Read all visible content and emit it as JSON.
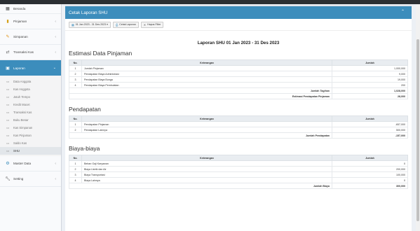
{
  "sidebar": {
    "partial_label": "Beranda",
    "items": [
      {
        "label": "Pinjaman",
        "icon": "money-icon"
      },
      {
        "label": "Simpanan",
        "icon": "pencil-icon"
      },
      {
        "label": "Transaksi Kas",
        "icon": "exchange-icon"
      },
      {
        "label": "Laporan",
        "icon": "book-icon"
      }
    ],
    "sub_items": [
      "Data Anggota",
      "Kas Anggota",
      "Jatuh Tempo",
      "Kredit Macet",
      "Transaksi Kas",
      "Buku Besar",
      "Kas Simpanan",
      "Kas Pinjaman",
      "Saldo Kas",
      "SHU"
    ],
    "bottom_items": [
      {
        "label": "Master Data",
        "icon": "gears-icon"
      },
      {
        "label": "Setting",
        "icon": "wrench-icon"
      }
    ]
  },
  "box": {
    "title": "Cetak Laporan SHU",
    "collapse_glyph": "⌃"
  },
  "toolbar": {
    "date_range": "01 Jan 2023 - 31 Des 2023 ▾",
    "print_label": "Cetak Laporan",
    "clear_label": "Hapus Filter"
  },
  "report": {
    "title": "Laporan SHU 01 Jan 2023 - 31 Des 2023"
  },
  "headers": {
    "no": "No.",
    "ket": "Keterangan",
    "jumlah": "Jumlah"
  },
  "sections": {
    "pinjaman": {
      "title": "Estimasi Data Pinjaman",
      "rows": [
        {
          "no": "1",
          "ket": "Jumlah Pinjaman",
          "amt": "1,000,000"
        },
        {
          "no": "2",
          "ket": "Pendapatan Biaya Administrasi",
          "amt": "9,000"
        },
        {
          "no": "3",
          "ket": "Pendapatan Biaya Bunga",
          "amt": "19,000"
        },
        {
          "no": "4",
          "ket": "Pendapatan Biaya Pembulatan",
          "amt": "200"
        }
      ],
      "sums": [
        {
          "label": "Jumlah Tagihan",
          "amt": "1,028,000"
        },
        {
          "label": "Estimasi Pendapatan Pinjaman",
          "amt": "28,000"
        }
      ]
    },
    "pendapatan": {
      "title": "Pendapatan",
      "rows": [
        {
          "no": "1",
          "ket": "Pendapatan Pinjaman",
          "amt": "-657,000"
        },
        {
          "no": "2",
          "ket": "Pendapatan Lainnya",
          "amt": "500,000"
        }
      ],
      "sums": [
        {
          "label": "Jumlah Pendapatan",
          "amt": "-157,000"
        }
      ]
    },
    "biaya": {
      "title": "Biaya-biaya",
      "rows": [
        {
          "no": "1",
          "ket": "Beban Gaji Karyawan",
          "amt": "0"
        },
        {
          "no": "2",
          "ket": "Biaya Listrik dan Air",
          "amt": "200,000"
        },
        {
          "no": "3",
          "ket": "Biaya Transportasi",
          "amt": "100,000"
        },
        {
          "no": "4",
          "ket": "Biaya Lainnya",
          "amt": "0"
        }
      ],
      "sums": [
        {
          "label": "Jumlah Biaya",
          "amt": "300,000"
        }
      ]
    }
  },
  "colors": {
    "accent": "#3c8dbc",
    "header_bg": "#2b2f33"
  }
}
